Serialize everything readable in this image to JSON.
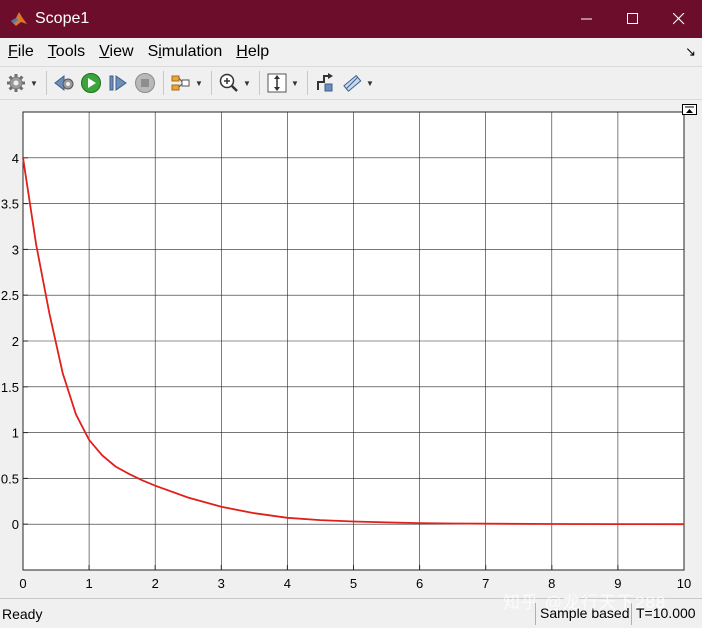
{
  "window": {
    "title": "Scope1"
  },
  "menu": {
    "items": [
      {
        "label": "File",
        "key": "F",
        "rest": "ile"
      },
      {
        "label": "Tools",
        "key": "T",
        "rest": "ools"
      },
      {
        "label": "View",
        "key": "V",
        "rest": "iew"
      },
      {
        "label": "Simulation",
        "key": "i",
        "pre": "S",
        "rest": "mulation"
      },
      {
        "label": "Help",
        "key": "H",
        "rest": "elp"
      }
    ],
    "dock_glyph": "↘"
  },
  "toolbar": {
    "icons": [
      "settings-gear-icon",
      "step-back-icon",
      "run-icon",
      "step-forward-icon",
      "stop-icon",
      "signal-select-icon",
      "zoom-in-icon",
      "autoscale-icon",
      "style-icon",
      "measure-icon"
    ]
  },
  "chart_data": {
    "type": "line",
    "xlim": [
      0,
      10
    ],
    "ylim": [
      -0.5,
      4.5
    ],
    "x_ticks": [
      "0",
      "1",
      "2",
      "3",
      "4",
      "5",
      "6",
      "7",
      "8",
      "9",
      "10"
    ],
    "y_ticks": [
      "0",
      "0.5",
      "1",
      "1.5",
      "2",
      "2.5",
      "3",
      "3.5",
      "4"
    ],
    "grid": true,
    "series": [
      {
        "color": "#e0201b",
        "x": [
          0,
          0.2,
          0.4,
          0.6,
          0.8,
          1.0,
          1.2,
          1.4,
          1.6,
          1.8,
          2.0,
          2.5,
          3.0,
          3.5,
          4.0,
          4.5,
          5.0,
          5.5,
          6.0,
          6.5,
          7.0,
          8.0,
          9.0,
          10.0
        ],
        "y": [
          4.0,
          3.05,
          2.3,
          1.65,
          1.2,
          0.92,
          0.75,
          0.63,
          0.55,
          0.48,
          0.42,
          0.29,
          0.19,
          0.12,
          0.07,
          0.045,
          0.03,
          0.02,
          0.012,
          0.008,
          0.005,
          0.002,
          0.001,
          0.0
        ]
      }
    ]
  },
  "status": {
    "ready": "Ready",
    "sample": "Sample based",
    "time": "T=10.000"
  },
  "watermark": "知乎 @龙行天下288"
}
